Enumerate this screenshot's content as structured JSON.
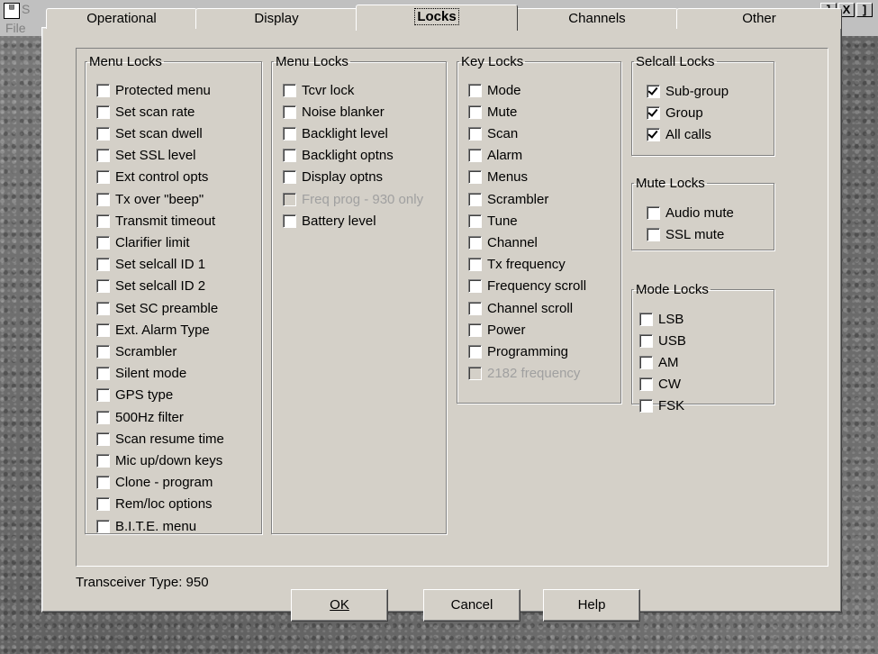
{
  "app": {
    "title_fragment": "S",
    "menu_file": "File",
    "window_controls": [
      "]",
      "X",
      "]"
    ]
  },
  "tabs": [
    {
      "label": "Operational",
      "active": false
    },
    {
      "label": "Display",
      "active": false
    },
    {
      "label": "Locks",
      "active": true
    },
    {
      "label": "Channels",
      "active": false
    },
    {
      "label": "Other",
      "active": false
    }
  ],
  "groups": {
    "menu_locks_1": {
      "title": "Menu Locks",
      "items": [
        {
          "label": "Protected menu",
          "checked": false
        },
        {
          "label": "Set scan rate",
          "checked": false
        },
        {
          "label": "Set scan dwell",
          "checked": false
        },
        {
          "label": "Set SSL level",
          "checked": false
        },
        {
          "label": "Ext control opts",
          "checked": false
        },
        {
          "label": "Tx over \"beep\"",
          "checked": false
        },
        {
          "label": "Transmit timeout",
          "checked": false
        },
        {
          "label": "Clarifier limit",
          "checked": false
        },
        {
          "label": "Set selcall ID 1",
          "checked": false
        },
        {
          "label": "Set selcall ID 2",
          "checked": false
        },
        {
          "label": "Set SC preamble",
          "checked": false
        },
        {
          "label": "Ext. Alarm Type",
          "checked": false
        },
        {
          "label": "Scrambler",
          "checked": false
        },
        {
          "label": "Silent mode",
          "checked": false
        },
        {
          "label": "GPS type",
          "checked": false
        },
        {
          "label": "500Hz filter",
          "checked": false
        },
        {
          "label": "Scan resume time",
          "checked": false
        },
        {
          "label": "Mic up/down keys",
          "checked": false
        },
        {
          "label": "Clone - program",
          "checked": false
        },
        {
          "label": "Rem/loc options",
          "checked": false
        },
        {
          "label": "B.I.T.E. menu",
          "checked": false
        }
      ]
    },
    "menu_locks_2": {
      "title": "Menu Locks",
      "items": [
        {
          "label": "Tcvr lock",
          "checked": false
        },
        {
          "label": "Noise blanker",
          "checked": false
        },
        {
          "label": "Backlight level",
          "checked": false
        },
        {
          "label": "Backlight optns",
          "checked": false
        },
        {
          "label": "Display optns",
          "checked": false
        },
        {
          "label": "Freq prog - 930 only",
          "checked": false,
          "disabled": true
        },
        {
          "label": "Battery level",
          "checked": false
        }
      ]
    },
    "key_locks": {
      "title": "Key Locks",
      "items": [
        {
          "label": "Mode",
          "checked": false
        },
        {
          "label": "Mute",
          "checked": false
        },
        {
          "label": "Scan",
          "checked": false
        },
        {
          "label": "Alarm",
          "checked": false
        },
        {
          "label": "Menus",
          "checked": false
        },
        {
          "label": "Scrambler",
          "checked": false
        },
        {
          "label": "Tune",
          "checked": false
        },
        {
          "label": "Channel",
          "checked": false
        },
        {
          "label": "Tx frequency",
          "checked": false
        },
        {
          "label": "Frequency scroll",
          "checked": false
        },
        {
          "label": "Channel scroll",
          "checked": false
        },
        {
          "label": "Power",
          "checked": false
        },
        {
          "label": "Programming",
          "checked": false
        },
        {
          "label": "2182 frequency",
          "checked": false,
          "disabled": true
        }
      ]
    },
    "selcall_locks": {
      "title": "Selcall Locks",
      "items": [
        {
          "label": "Sub-group",
          "checked": true
        },
        {
          "label": "Group",
          "checked": true
        },
        {
          "label": "All calls",
          "checked": true
        }
      ]
    },
    "mute_locks": {
      "title": "Mute Locks",
      "items": [
        {
          "label": "Audio mute",
          "checked": false
        },
        {
          "label": "SSL mute",
          "checked": false
        }
      ]
    },
    "mode_locks": {
      "title": "Mode Locks",
      "items": [
        {
          "label": "LSB",
          "checked": false
        },
        {
          "label": "USB",
          "checked": false
        },
        {
          "label": "AM",
          "checked": false
        },
        {
          "label": "CW",
          "checked": false
        },
        {
          "label": "FSK",
          "checked": false
        }
      ]
    }
  },
  "status": {
    "transceiver_type": "Transceiver Type: 950"
  },
  "buttons": {
    "ok": "OK",
    "cancel": "Cancel",
    "help": "Help"
  },
  "colors": {
    "dialog_bg": "#d4d0c8",
    "backdrop": "#6a6a6a"
  }
}
